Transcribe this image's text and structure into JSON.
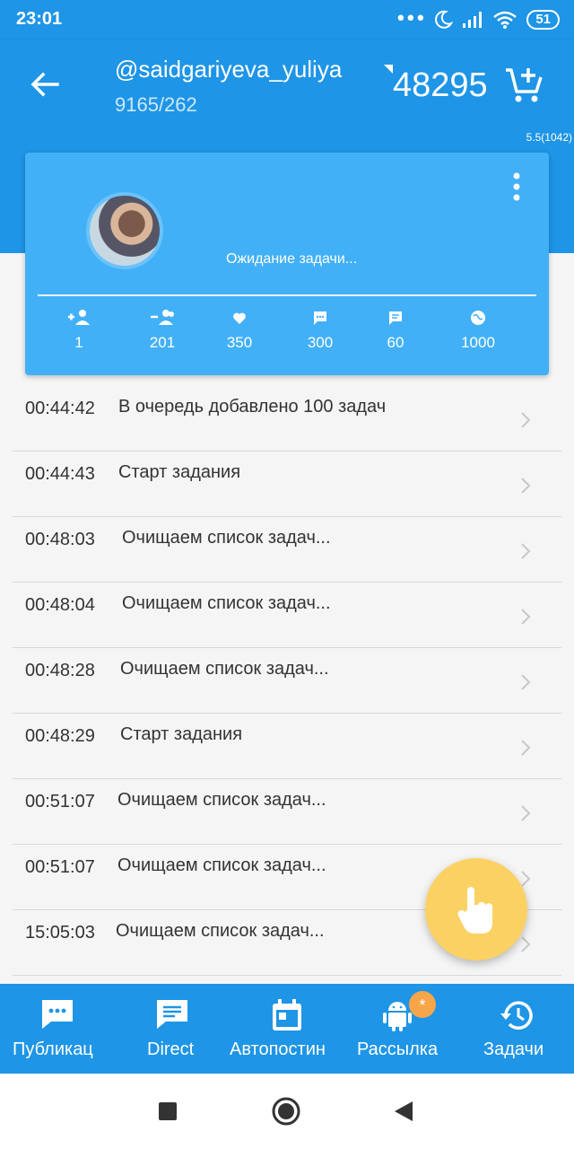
{
  "status_bar": {
    "time": "23:01",
    "battery": "51"
  },
  "header": {
    "username": "@saidgariyeva_yuliya",
    "stats": "9165/262",
    "balance": "48295",
    "version": "5.5(1042)"
  },
  "card": {
    "status": "Ожидание задачи...",
    "stats": [
      {
        "icon": "add-user-icon",
        "value": "1"
      },
      {
        "icon": "remove-user-icon",
        "value": "201"
      },
      {
        "icon": "heart-icon",
        "value": "350"
      },
      {
        "icon": "comment-icon",
        "value": "300"
      },
      {
        "icon": "message-icon",
        "value": "60"
      },
      {
        "icon": "globe-icon",
        "value": "1000"
      }
    ]
  },
  "log": [
    {
      "time": "00:44:42",
      "text": "В очередь добавлено 100 задач"
    },
    {
      "time": "00:44:43",
      "text": "Старт задания"
    },
    {
      "time": "00:48:03",
      "text": "Очищаем список задач..."
    },
    {
      "time": "00:48:04",
      "text": "Очищаем список задач..."
    },
    {
      "time": "00:48:28",
      "text": "Очищаем список задач..."
    },
    {
      "time": "00:48:29",
      "text": "Старт задания"
    },
    {
      "time": "00:51:07",
      "text": "Очищаем список задач..."
    },
    {
      "time": "00:51:07",
      "text": "Очищаем список задач..."
    },
    {
      "time": "15:05:03",
      "text": "Очищаем список задач..."
    }
  ],
  "bottom_nav": [
    {
      "icon": "publication-icon",
      "label": "Публикац"
    },
    {
      "icon": "direct-icon",
      "label": "Direct"
    },
    {
      "icon": "calendar-icon",
      "label": "Автопостин"
    },
    {
      "icon": "android-icon",
      "label": "Рассылка",
      "badge": "*"
    },
    {
      "icon": "history-icon",
      "label": "Задачи"
    }
  ],
  "colors": {
    "primary": "#1e95e6",
    "card": "#42b0f7",
    "fab": "#fcd163",
    "badge": "#f7a54a"
  }
}
